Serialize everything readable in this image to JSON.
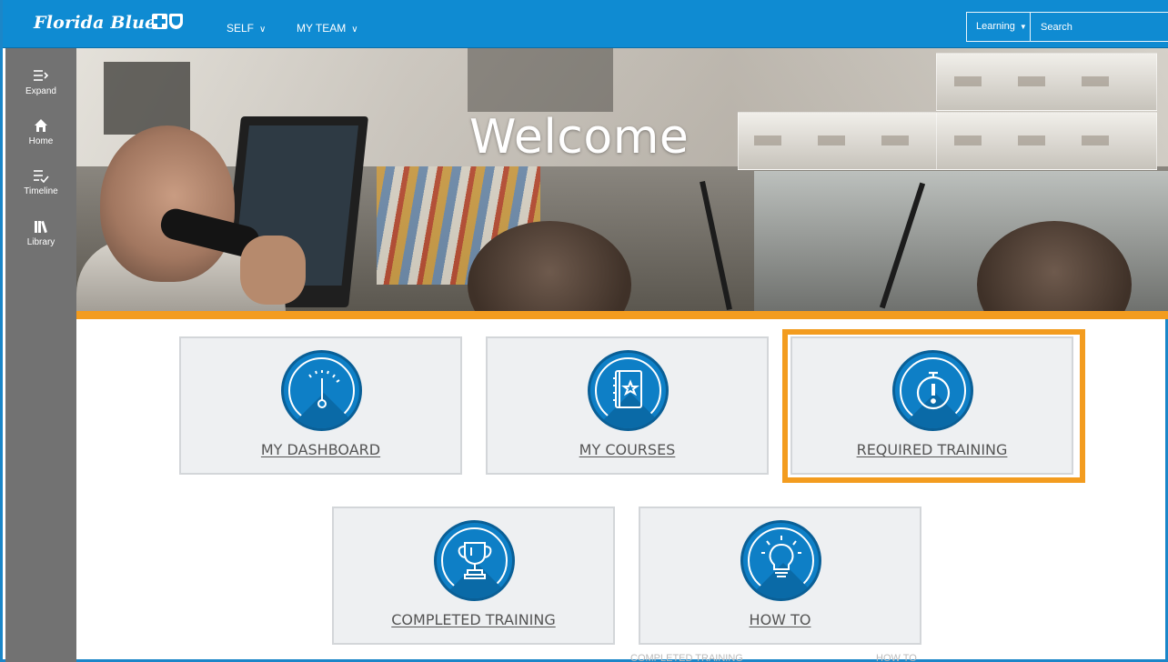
{
  "header": {
    "brand": "Florida Blue",
    "nav": [
      {
        "label": "SELF"
      },
      {
        "label": "MY TEAM"
      }
    ],
    "learning_select": "Learning",
    "search_placeholder": "Search"
  },
  "sidebar": {
    "items": [
      {
        "label": "Expand",
        "icon": "expand-icon"
      },
      {
        "label": "Home",
        "icon": "home-icon"
      },
      {
        "label": "Timeline",
        "icon": "timeline-icon"
      },
      {
        "label": "Library",
        "icon": "library-icon"
      }
    ]
  },
  "hero": {
    "title": "Welcome"
  },
  "tiles": [
    {
      "label": "MY DASHBOARD",
      "icon": "dashboard-gauge-icon"
    },
    {
      "label": "MY COURSES",
      "icon": "course-book-icon"
    },
    {
      "label": "REQUIRED TRAINING",
      "icon": "stopwatch-alert-icon",
      "highlighted": true
    },
    {
      "label": "COMPLETED TRAINING",
      "icon": "trophy-icon"
    },
    {
      "label": "HOW TO",
      "icon": "lightbulb-icon"
    }
  ],
  "footer_ghost": {
    "left": "COMPLETED TRAINING",
    "right": "HOW TO"
  },
  "colors": {
    "topbar": "#0f8bd2",
    "sidebar": "#727272",
    "accent_orange": "#f39c1f",
    "tile_icon": "#0e7fc6",
    "tile_bg": "#eef0f2"
  }
}
